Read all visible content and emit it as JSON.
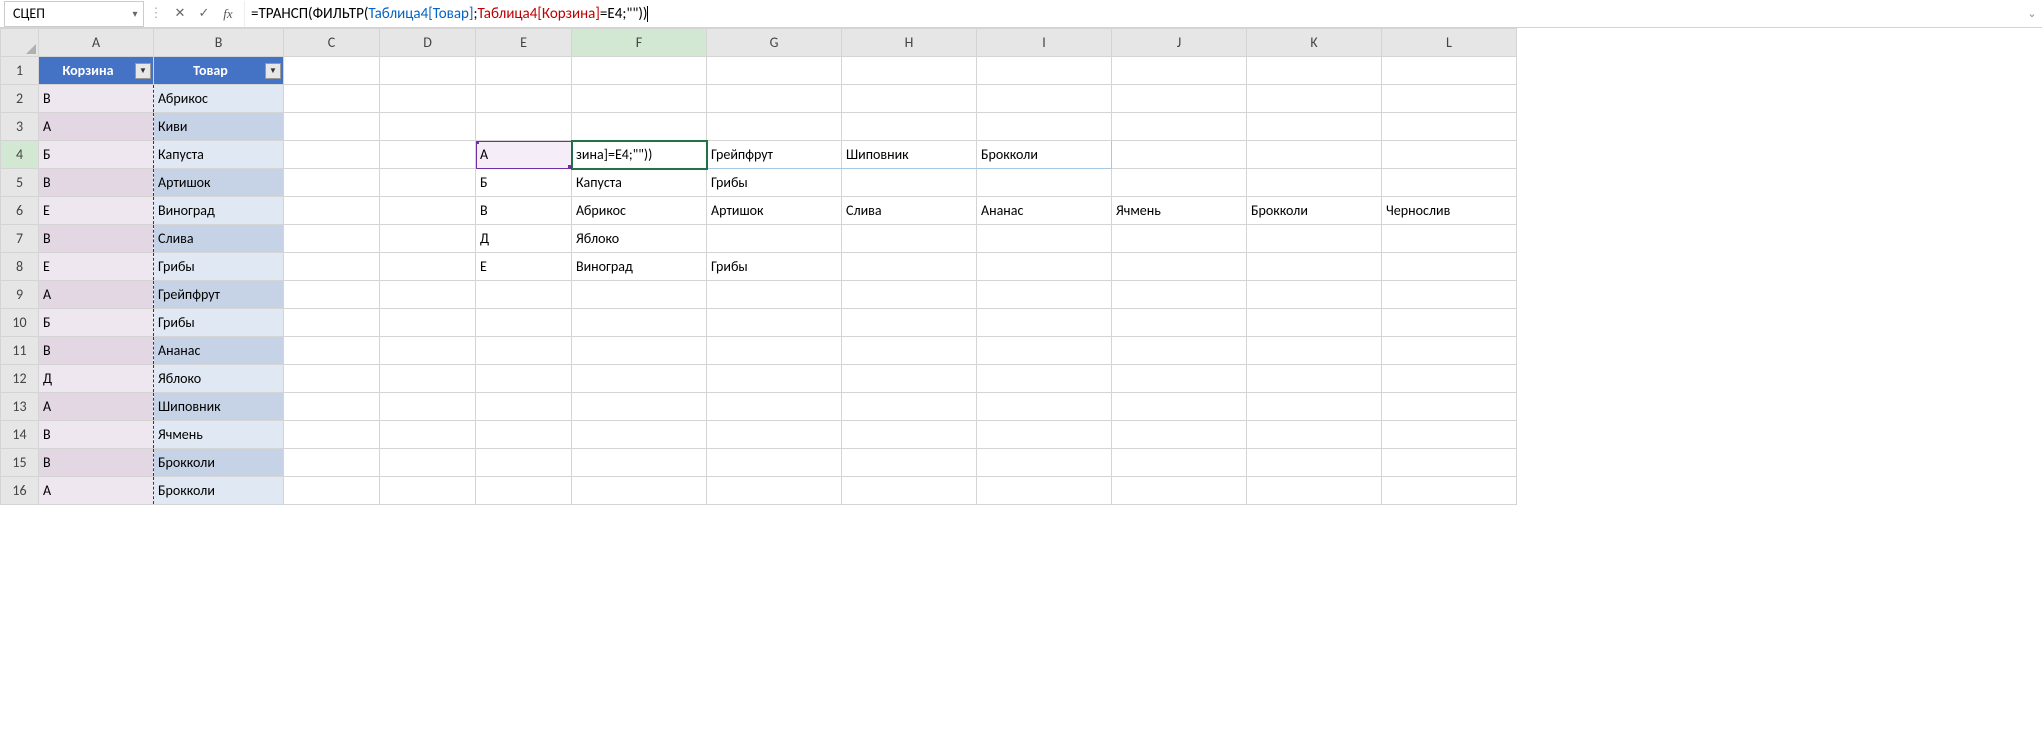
{
  "name_box": "СЦЕП",
  "formula": {
    "prefix": "=ТРАНСП(ФИЛЬТР(",
    "ref1": "Таблица4[Товар]",
    "sep1": ";",
    "ref2": "Таблица4[Корзина]",
    "eq": "=E4;\"\"))",
    "display_in_cell": "зина]=E4;\"\"))"
  },
  "columns": [
    "A",
    "B",
    "C",
    "D",
    "E",
    "F",
    "G",
    "H",
    "I",
    "J",
    "K",
    "L"
  ],
  "row_count": 16,
  "table_headers": {
    "A": "Корзина",
    "B": "Товар"
  },
  "table_rows": [
    {
      "A": "В",
      "B": "Абрикос"
    },
    {
      "A": "А",
      "B": "Киви"
    },
    {
      "A": "Б",
      "B": "Капуста"
    },
    {
      "A": "В",
      "B": "Артишок"
    },
    {
      "A": "Е",
      "B": "Виноград"
    },
    {
      "A": "В",
      "B": "Слива"
    },
    {
      "A": "Е",
      "B": "Грибы"
    },
    {
      "A": "А",
      "B": "Грейпфрут"
    },
    {
      "A": "Б",
      "B": "Грибы"
    },
    {
      "A": "В",
      "B": "Ананас"
    },
    {
      "A": "Д",
      "B": "Яблоко"
    },
    {
      "A": "А",
      "B": "Шиповник"
    },
    {
      "A": "В",
      "B": "Ячмень"
    },
    {
      "A": "В",
      "B": "Брокколи"
    },
    {
      "A": "А",
      "B": "Брокколи"
    }
  ],
  "result_area": {
    "4": {
      "E": "А",
      "G": "Грейпфрут",
      "H": "Шиповник",
      "I": "Брокколи"
    },
    "5": {
      "E": "Б",
      "F": "Капуста",
      "G": "Грибы"
    },
    "6": {
      "E": "В",
      "F": "Абрикос",
      "G": "Артишок",
      "H": "Слива",
      "I": "Ананас",
      "J": "Ячмень",
      "K": "Брокколи",
      "L": "Чернослив"
    },
    "7": {
      "E": "Д",
      "F": "Яблоко"
    },
    "8": {
      "E": "Е",
      "F": "Виноград",
      "G": "Грибы"
    }
  },
  "active_cell": {
    "row": 4,
    "col": "F"
  },
  "ref_cell": {
    "row": 4,
    "col": "E"
  }
}
